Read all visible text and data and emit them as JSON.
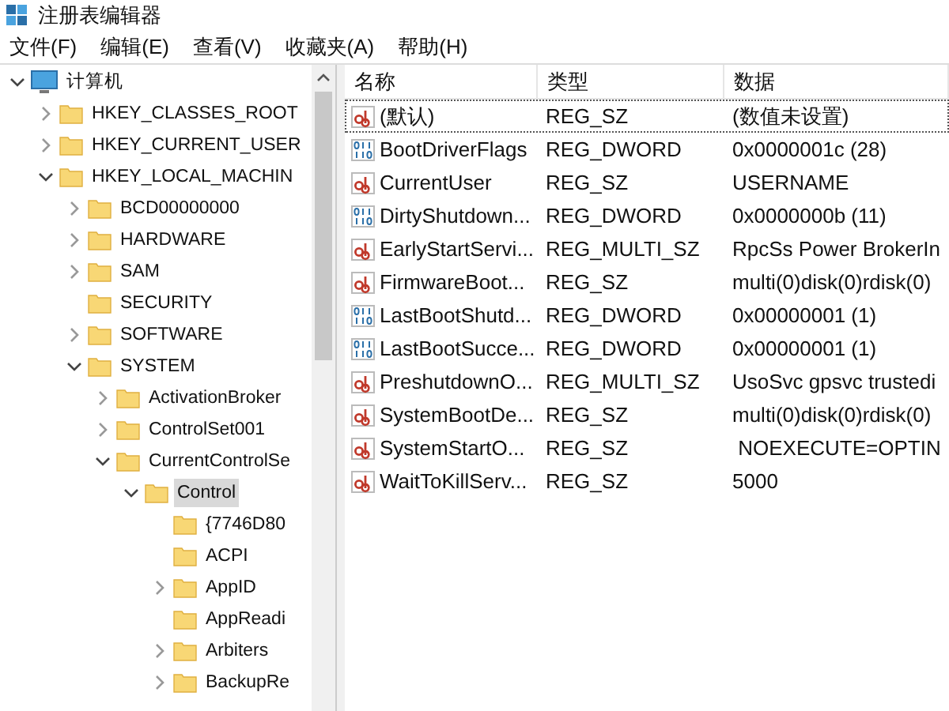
{
  "window": {
    "title": "注册表编辑器"
  },
  "menu": [
    "文件(F)",
    "编辑(E)",
    "查看(V)",
    "收藏夹(A)",
    "帮助(H)"
  ],
  "tree": [
    {
      "label": "计算机",
      "kind": "computer",
      "expandable": true,
      "expanded": true,
      "selected": false,
      "children": [
        {
          "label": "HKEY_CLASSES_ROOT",
          "kind": "folder",
          "expandable": true,
          "expanded": false,
          "selected": false
        },
        {
          "label": "HKEY_CURRENT_USER",
          "kind": "folder",
          "expandable": true,
          "expanded": false,
          "selected": false
        },
        {
          "label": "HKEY_LOCAL_MACHIN",
          "kind": "folder",
          "expandable": true,
          "expanded": true,
          "selected": false,
          "children": [
            {
              "label": "BCD00000000",
              "kind": "folder",
              "expandable": true,
              "expanded": false,
              "selected": false
            },
            {
              "label": "HARDWARE",
              "kind": "folder",
              "expandable": true,
              "expanded": false,
              "selected": false
            },
            {
              "label": "SAM",
              "kind": "folder",
              "expandable": true,
              "expanded": false,
              "selected": false
            },
            {
              "label": "SECURITY",
              "kind": "folder",
              "expandable": false,
              "selected": false
            },
            {
              "label": "SOFTWARE",
              "kind": "folder",
              "expandable": true,
              "expanded": false,
              "selected": false
            },
            {
              "label": "SYSTEM",
              "kind": "folder",
              "expandable": true,
              "expanded": true,
              "selected": false,
              "children": [
                {
                  "label": "ActivationBroker",
                  "kind": "folder",
                  "expandable": true,
                  "expanded": false,
                  "selected": false
                },
                {
                  "label": "ControlSet001",
                  "kind": "folder",
                  "expandable": true,
                  "expanded": false,
                  "selected": false
                },
                {
                  "label": "CurrentControlSe",
                  "kind": "folder",
                  "expandable": true,
                  "expanded": true,
                  "selected": false,
                  "children": [
                    {
                      "label": "Control",
                      "kind": "folder",
                      "expandable": true,
                      "expanded": true,
                      "selected": true,
                      "children": [
                        {
                          "label": "{7746D80",
                          "kind": "folder",
                          "expandable": false,
                          "selected": false
                        },
                        {
                          "label": "ACPI",
                          "kind": "folder",
                          "expandable": false,
                          "selected": false
                        },
                        {
                          "label": "AppID",
                          "kind": "folder",
                          "expandable": true,
                          "expanded": false,
                          "selected": false
                        },
                        {
                          "label": "AppReadi",
                          "kind": "folder",
                          "expandable": false,
                          "selected": false
                        },
                        {
                          "label": "Arbiters",
                          "kind": "folder",
                          "expandable": true,
                          "expanded": false,
                          "selected": false
                        },
                        {
                          "label": "BackupRe",
                          "kind": "folder",
                          "expandable": true,
                          "expanded": false,
                          "selected": false
                        }
                      ]
                    }
                  ]
                }
              ]
            }
          ]
        }
      ]
    }
  ],
  "table": {
    "columns": [
      "名称",
      "类型",
      "数据"
    ],
    "rows": [
      {
        "name": "(默认)",
        "type": "REG_SZ",
        "data": "(数值未设置)",
        "kind": "string",
        "selected": true
      },
      {
        "name": "BootDriverFlags",
        "type": "REG_DWORD",
        "data": "0x0000001c (28)",
        "kind": "binary",
        "selected": false
      },
      {
        "name": "CurrentUser",
        "type": "REG_SZ",
        "data": "USERNAME",
        "kind": "string",
        "selected": false
      },
      {
        "name": "DirtyShutdown...",
        "type": "REG_DWORD",
        "data": "0x0000000b (11)",
        "kind": "binary",
        "selected": false
      },
      {
        "name": "EarlyStartServi...",
        "type": "REG_MULTI_SZ",
        "data": "RpcSs Power BrokerIn",
        "kind": "string",
        "selected": false
      },
      {
        "name": "FirmwareBoot...",
        "type": "REG_SZ",
        "data": "multi(0)disk(0)rdisk(0)",
        "kind": "string",
        "selected": false
      },
      {
        "name": "LastBootShutd...",
        "type": "REG_DWORD",
        "data": "0x00000001 (1)",
        "kind": "binary",
        "selected": false
      },
      {
        "name": "LastBootSucce...",
        "type": "REG_DWORD",
        "data": "0x00000001 (1)",
        "kind": "binary",
        "selected": false
      },
      {
        "name": "PreshutdownO...",
        "type": "REG_MULTI_SZ",
        "data": "UsoSvc gpsvc trustedi",
        "kind": "string",
        "selected": false
      },
      {
        "name": "SystemBootDe...",
        "type": "REG_SZ",
        "data": "multi(0)disk(0)rdisk(0)",
        "kind": "string",
        "selected": false
      },
      {
        "name": "SystemStartO...",
        "type": "REG_SZ",
        "data": " NOEXECUTE=OPTIN",
        "kind": "string",
        "selected": false
      },
      {
        "name": "WaitToKillServ...",
        "type": "REG_SZ",
        "data": "5000",
        "kind": "string",
        "selected": false
      }
    ]
  }
}
